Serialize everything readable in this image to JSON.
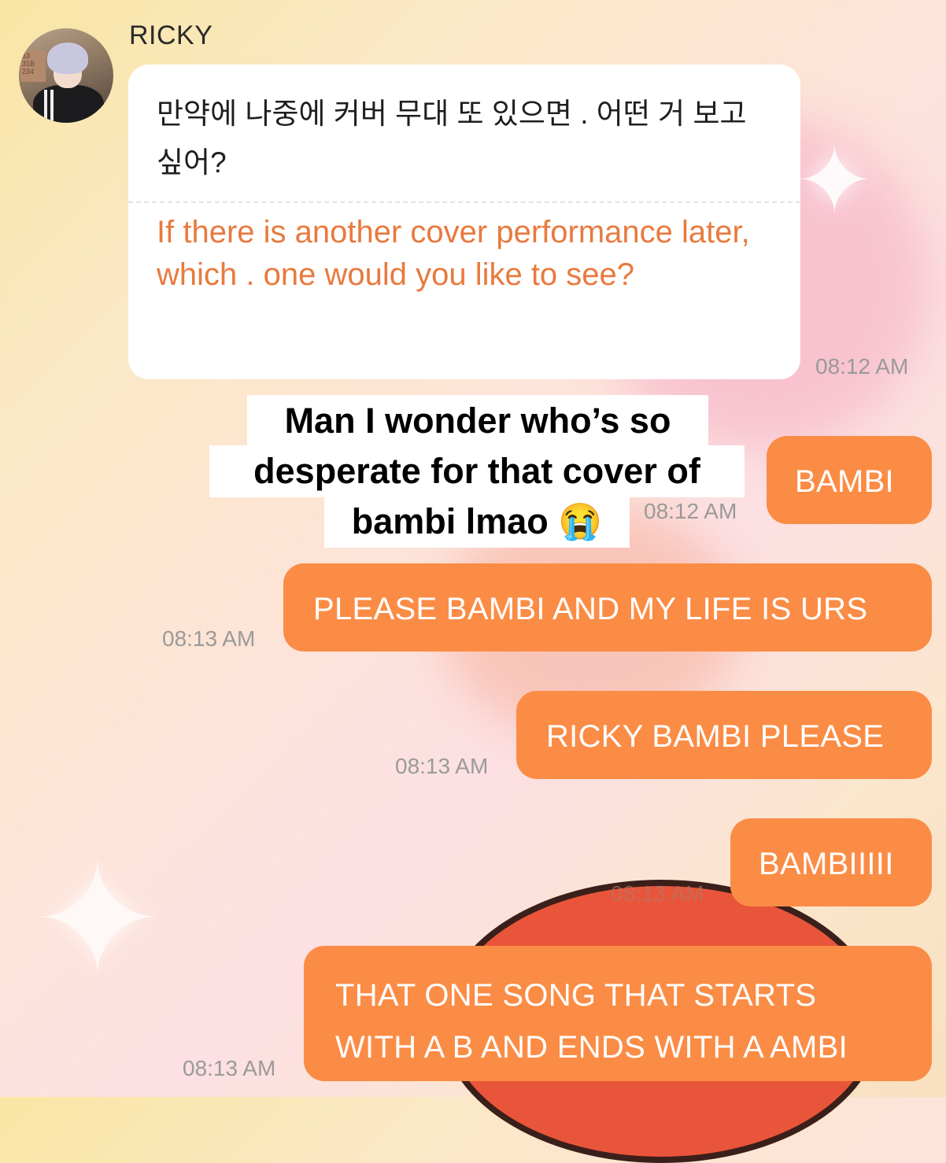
{
  "contact": {
    "name": "RICKY",
    "avatar_sign": "53 31B 234"
  },
  "messages": [
    {
      "from": "RICKY",
      "text_korean": "만약에 나중에 커버 무대 또 있으면 . 어떤 거 보고 싶어?",
      "text_translation": "If there is another cover performance later, which . one would you like to see?",
      "time": "08:12 AM"
    },
    {
      "from": "me",
      "text": "BAMBI",
      "time": "08:12 AM"
    },
    {
      "from": "me",
      "text": "PLEASE BAMBI AND MY LIFE IS URS",
      "time": "08:13 AM"
    },
    {
      "from": "me",
      "text": "RICKY BAMBI PLEASE",
      "time": "08:13 AM"
    },
    {
      "from": "me",
      "text": "BAMBIIIII",
      "time": "08:13 AM"
    },
    {
      "from": "me",
      "text_line1": "THAT ONE SONG THAT STARTS",
      "text_line2": "WITH A B AND ENDS WITH A AMBI",
      "time": "08:13 AM"
    }
  ],
  "overlay_caption": {
    "line1": "Man I wonder who’s so",
    "line2": "desperate for that cover of",
    "line3": "bambi lmao 😭"
  },
  "colors": {
    "outgoing_bubble": "#fb8c45",
    "translation_text": "#e87a3e",
    "timestamp": "#9a9a9a"
  }
}
